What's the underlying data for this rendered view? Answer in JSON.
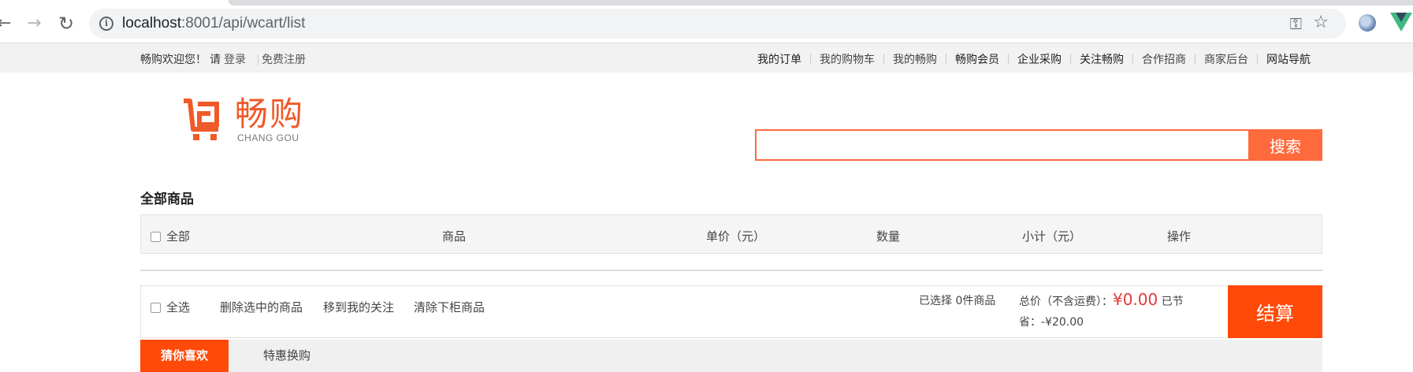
{
  "browser": {
    "url_host": "localhost",
    "url_rest": ":8001/api/wcart/list"
  },
  "topbar": {
    "welcome": "畅购欢迎您！",
    "please": "请",
    "login": "登录",
    "register": "免费注册",
    "menu": [
      "我的订单",
      "我的购物车",
      "我的畅购",
      "畅购会员",
      "企业采购",
      "关注畅购",
      "合作招商",
      "商家后台",
      "网站导航"
    ]
  },
  "logo": {
    "cn": "畅购",
    "en": "CHANG GOU"
  },
  "search": {
    "button": "搜索",
    "value": ""
  },
  "section_title": "全部商品",
  "table_header": {
    "all": "全部",
    "product": "商品",
    "unit_price": "单价（元）",
    "quantity": "数量",
    "subtotal": "小计（元）",
    "action": "操作"
  },
  "footer": {
    "select_all": "全选",
    "delete_selected": "删除选中的商品",
    "move_to_follow": "移到我的关注",
    "clear_offshelf": "清除下柜商品",
    "selected": "已选择 0件商品",
    "total_label": "总价（不含运费）：",
    "total_price": "¥0.00",
    "saved_prefix": "已节",
    "saved": "省：-¥20.00",
    "checkout": "结算"
  },
  "tabs": [
    "猜你喜欢",
    "特惠换购"
  ],
  "colors": {
    "brand_orange": "#ff6a3d",
    "checkout_orange": "#ff4a0a",
    "price_red": "#e4393c"
  }
}
